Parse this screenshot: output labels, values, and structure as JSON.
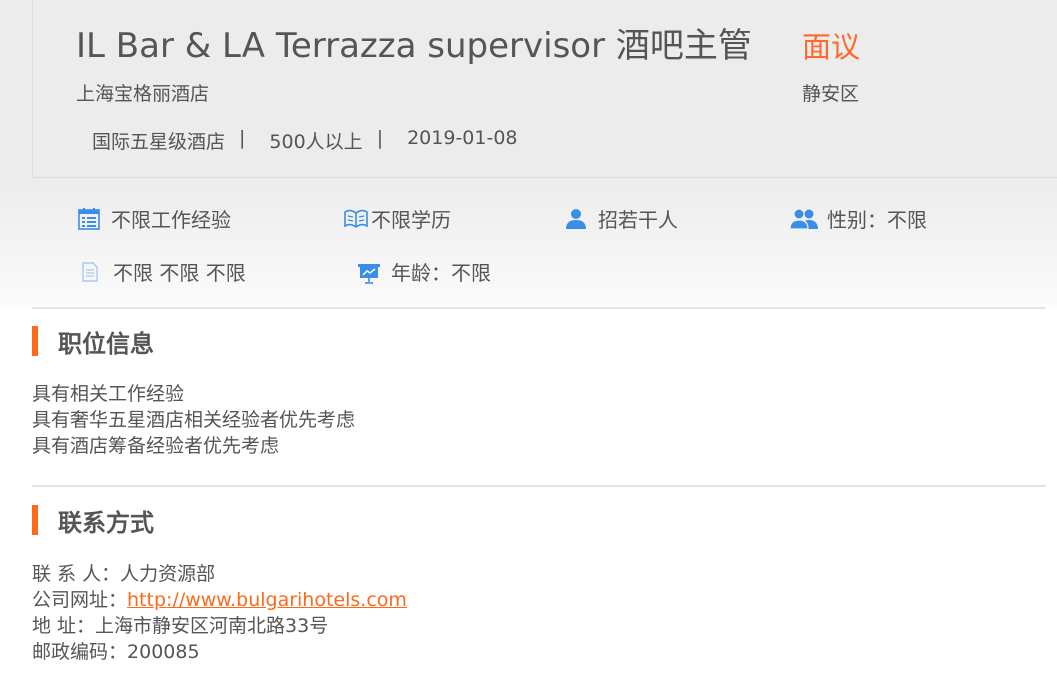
{
  "header": {
    "title": "IL Bar & LA Terrazza supervisor 酒吧主管",
    "salary": "面议",
    "company": "上海宝格丽酒店",
    "district": "静安区",
    "meta": [
      "国际五星级酒店",
      "500人以上",
      "2019-01-08"
    ],
    "separator": "|"
  },
  "requirements": [
    {
      "icon": "calendar-icon",
      "label": "不限工作经验"
    },
    {
      "icon": "book-icon",
      "label": "不限学历"
    },
    {
      "icon": "person-icon",
      "label": "招若干人"
    },
    {
      "icon": "people-icon",
      "label": "性别：不限"
    },
    {
      "icon": "document-icon",
      "label": "不限 不限 不限"
    },
    {
      "icon": "presentation-icon",
      "label": "年龄：不限"
    }
  ],
  "position_info": {
    "title": "职位信息",
    "lines": [
      "具有相关工作经验",
      "具有奢华五星酒店相关经验者优先考虑",
      "具有酒店筹备经验者优先考虑"
    ]
  },
  "contact": {
    "title": "联系方式",
    "person_label": "联 系 人：",
    "person": "人力资源部",
    "website_label": "公司网址：",
    "website": "http://www.bulgarihotels.com",
    "address_label": "地 址：",
    "address": "上海市静安区河南北路33号",
    "postcode_label": "邮政编码：",
    "postcode": "200085"
  },
  "colors": {
    "accent": "#ff6a1a",
    "icon": "#3a8ee6",
    "text": "#555555"
  }
}
